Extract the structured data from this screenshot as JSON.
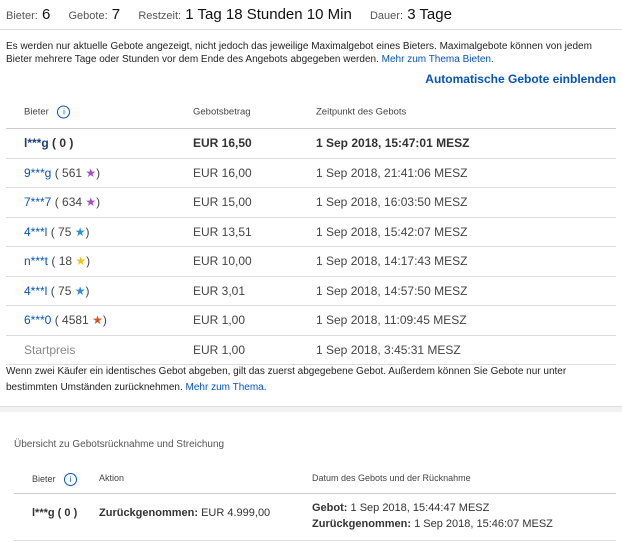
{
  "stats": {
    "bidders_label": "Bieter:",
    "bidders_value": "6",
    "bids_label": "Gebote:",
    "bids_value": "7",
    "remaining_label": "Restzeit:",
    "remaining_value": "1 Tag 18 Stunden 10 Min",
    "duration_label": "Dauer:",
    "duration_value": "3 Tage"
  },
  "info": {
    "text": "Es werden nur aktuelle Gebote angezeigt, nicht jedoch das jeweilige Maximalgebot eines Bieters. Maximalgebote können von jedem Bieter mehrere Tage oder Stunden vor dem Ende des Angebots abgegeben werden.",
    "link": "Mehr zum Thema Bieten."
  },
  "auto_bids_link": "Automatische Gebote einblenden",
  "bids_table": {
    "headers": {
      "bidder": "Bieter",
      "amount": "Gebotsbetrag",
      "time": "Zeitpunkt des Gebots"
    },
    "rows": [
      {
        "bidder": "l***g",
        "feedback": "( 0 )",
        "star": "",
        "star_color": "",
        "amount": "EUR 16,50",
        "time": "1 Sep 2018, 15:47:01 MESZ"
      },
      {
        "bidder": "9***g",
        "feedback": "( 561",
        "star": "★",
        "star_color": "#a14ec9",
        "amount": "EUR 16,00",
        "time": "1 Sep 2018, 21:41:06 MESZ"
      },
      {
        "bidder": "7***7",
        "feedback": "( 634",
        "star": "★",
        "star_color": "#a14ec9",
        "amount": "EUR 15,00",
        "time": "1 Sep 2018, 16:03:50 MESZ"
      },
      {
        "bidder": "4***l",
        "feedback": "( 75",
        "star": "★",
        "star_color": "#2a8fd6",
        "amount": "EUR 13,51",
        "time": "1 Sep 2018, 15:42:07 MESZ"
      },
      {
        "bidder": "n***t",
        "feedback": "( 18",
        "star": "★",
        "star_color": "#f0c419",
        "amount": "EUR 10,00",
        "time": "1 Sep 2018, 14:17:43 MESZ"
      },
      {
        "bidder": "4***l",
        "feedback": "( 75",
        "star": "★",
        "star_color": "#2a8fd6",
        "amount": "EUR 3,01",
        "time": "1 Sep 2018, 14:57:50 MESZ"
      },
      {
        "bidder": "6***0",
        "feedback": "( 4581",
        "star": "★",
        "star_color": "#e0521b",
        "amount": "EUR 1,00",
        "time": "1 Sep 2018, 11:09:45 MESZ"
      }
    ],
    "start_row": {
      "label": "Startpreis",
      "amount": "EUR 1,00",
      "time": "1 Sep 2018, 3:45:31 MESZ"
    }
  },
  "note": {
    "text": "Wenn zwei Käufer ein identisches Gebot abgeben, gilt das zuerst abgegebene Gebot. Außerdem können Sie Gebote nur unter bestimmten Umständen zurücknehmen.",
    "link": "Mehr zum Thema."
  },
  "retractions": {
    "title": "Übersicht zu Gebotsrücknahme und Streichung",
    "headers": {
      "bidder": "Bieter",
      "action": "Aktion",
      "date": "Datum des Gebots und der Rücknahme"
    },
    "row": {
      "bidder": "l***g ( 0 )",
      "action_label": "Zurückgenommen:",
      "action_value": "EUR 4.999,00",
      "bid_label": "Gebot:",
      "bid_time": "1 Sep 2018, 15:44:47 MESZ",
      "retract_label": "Zurückgenommen:",
      "retract_time": "1 Sep 2018, 15:46:07 MESZ"
    }
  },
  "icons": {
    "info": "info-icon",
    "star": "feedback-star-icon"
  }
}
